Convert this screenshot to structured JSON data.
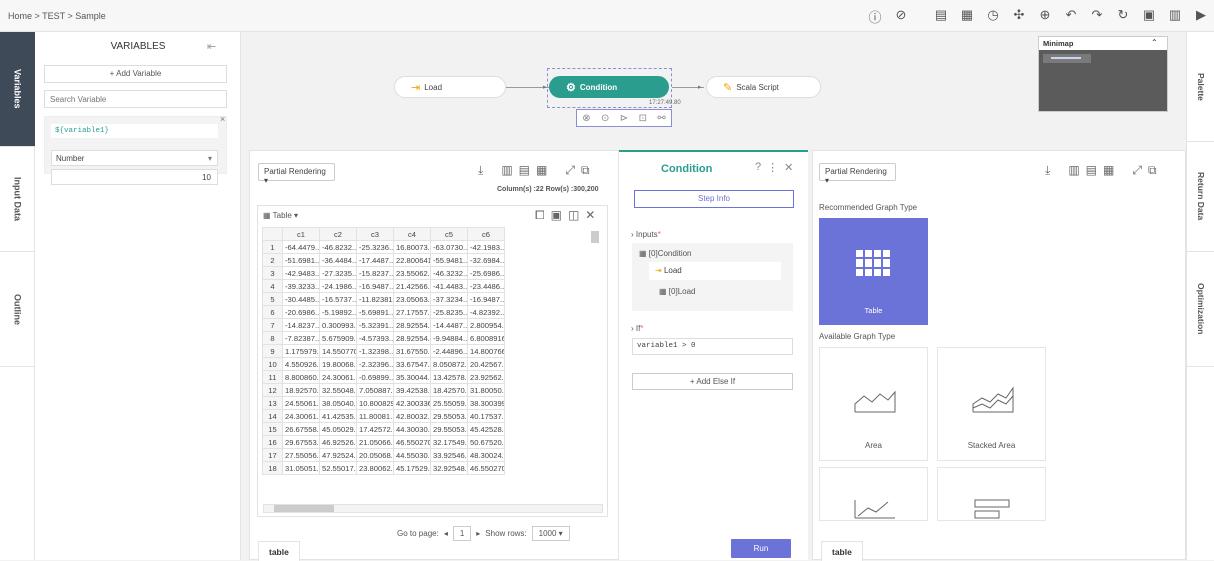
{
  "breadcrumb": "Home > TEST > Sample",
  "toolbar_icons": [
    "info-icon",
    "help-icon",
    "save-icon",
    "schedule-icon",
    "history-icon",
    "move-icon",
    "zoom-icon",
    "undo-icon",
    "redo-icon",
    "refresh-icon",
    "clipboard-icon",
    "calculator-icon",
    "play-icon"
  ],
  "left_tabs": [
    "Variables",
    "Input Data",
    "Outline"
  ],
  "right_tabs": [
    "Palette",
    "Return Data",
    "Optimization"
  ],
  "variables": {
    "title": "VARIABLES",
    "add_label": "+ Add Variable",
    "search_placeholder": "Search Variable",
    "var_name": "${variable1}",
    "var_type": "Number",
    "var_value": "10"
  },
  "canvas": {
    "nodes": [
      {
        "label": "Load"
      },
      {
        "label": "Condition",
        "time": "17:27:49.80"
      },
      {
        "label": "Scala Script"
      }
    ],
    "minimap_title": "Minimap"
  },
  "left_panel": {
    "rendering": "Partial Rendering",
    "column_info": "Column(s) :22  Row(s) :300,200",
    "table_title": "Table",
    "columns": [
      "c1",
      "c2",
      "c3",
      "c4",
      "c5",
      "c6"
    ],
    "rows": [
      [
        "1",
        "-64.4479...",
        "-46.8232...",
        "-25.3236...",
        "16.80073...",
        "-63.0730...",
        "-42.1983..."
      ],
      [
        "2",
        "-51.6981...",
        "-36.4484...",
        "-17.4487...",
        "22.8006416",
        "-55.9481...",
        "-32.6984..."
      ],
      [
        "3",
        "-42.9483...",
        "-27.3235...",
        "-15.8237...",
        "23.55062...",
        "-46.3232...",
        "-25.6986..."
      ],
      [
        "4",
        "-39.3233...",
        "-24.1986...",
        "-16.9487...",
        "21.42566...",
        "-41.4483...",
        "-23.4486..."
      ],
      [
        "5",
        "-30.4485...",
        "-16.5737...",
        "-11.82381...",
        "23.05063...",
        "-37.3234...",
        "-16.9487..."
      ],
      [
        "6",
        "-20.6986...",
        "-5.19892...",
        "-5.69891...",
        "27.17557...",
        "-25.8235...",
        "-4.82392..."
      ],
      [
        "7",
        "-14.8237...",
        "0.300993...",
        "-5.32391...",
        "28.92554...",
        "-14.4487...",
        "2.800954..."
      ],
      [
        "8",
        "-7.82387...",
        "5.675909...",
        "-4.57393...",
        "28.92554...",
        "-9.94884...",
        "6.8008916"
      ],
      [
        "9",
        "1.175979...",
        "14.5507705",
        "-1.32398...",
        "31.67550...",
        "-2.44896...",
        "14.8007666"
      ],
      [
        "10",
        "4.550926...",
        "19.80068...",
        "-2.32396...",
        "33.67547...",
        "8.050872...",
        "20.42567..."
      ],
      [
        "11",
        "8.800860...",
        "24.30061...",
        "-0.69899...",
        "35.30044...",
        "13.42578...",
        "23.92562..."
      ],
      [
        "12",
        "18.92570...",
        "32.55048...",
        "7.050887...",
        "39.42538...",
        "18.42570...",
        "31.80050..."
      ],
      [
        "13",
        "24.55061...",
        "38.05040...",
        "10.8008291",
        "42.3003369",
        "25.55059...",
        "38.3003994"
      ],
      [
        "14",
        "24.30061...",
        "41.42535...",
        "11.80081...",
        "42.80032...",
        "29.55053...",
        "40.17537..."
      ],
      [
        "15",
        "26.67558...",
        "45.05029...",
        "17.42572...",
        "44.30030...",
        "29.55053...",
        "45.42528..."
      ],
      [
        "16",
        "29.67553...",
        "46.92526...",
        "21.05066...",
        "46.5502705",
        "32.17549...",
        "50.67520..."
      ],
      [
        "17",
        "27.55056...",
        "47.92524...",
        "20.05068...",
        "44.55030...",
        "33.92546...",
        "48.30024..."
      ],
      [
        "18",
        "31.05051...",
        "52.55017...",
        "23.80062...",
        "45.17529...",
        "32.92548...",
        "46.5502705"
      ]
    ],
    "goto_label": "Go to page:",
    "page": "1",
    "show_rows_label": "Show rows:",
    "show_rows": "1000",
    "bottom_tab": "table"
  },
  "condition_panel": {
    "title": "Condition",
    "step_info": "Step Info",
    "inputs_label": "Inputs",
    "input_item": "[0]Condition",
    "load_label": "Load",
    "load_sub": "[0]Load",
    "if_label": "If",
    "if_expr": "variable1 > 0",
    "add_else_if": "+ Add Else If",
    "run": "Run"
  },
  "right_panel": {
    "rendering": "Partial Rendering",
    "recommended_label": "Recommended Graph Type",
    "recommended_name": "Table",
    "available_label": "Available Graph Type",
    "cards": [
      "Area",
      "Stacked Area"
    ],
    "bottom_tab": "table"
  },
  "colors": {
    "accent": "#6b73d8",
    "condition": "#2a9d8f",
    "sidebar_active": "#3f4a59"
  }
}
